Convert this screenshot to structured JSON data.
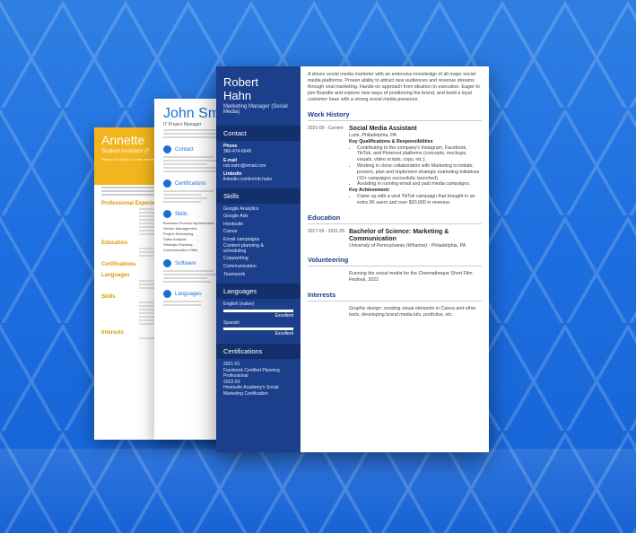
{
  "back_resume": {
    "name": "Annette",
    "title": "Student Assistant (F",
    "contact": "Phone: 0-0-0000 • E-mail: annette@mail.com",
    "sections": [
      "Professional Experie",
      "Education",
      "Certifications",
      "Languages",
      "Skills",
      "Interests"
    ]
  },
  "middle_resume": {
    "name": "John Sm",
    "title": "IT Project Manager",
    "sections": [
      "Contact",
      "Certifications",
      "Skills",
      "Software",
      "Languages"
    ],
    "skills": [
      "Business Process Improvement",
      "Vendor Management",
      "Project Scheduling",
      "Sales Analysis",
      "Strategic Planning",
      "Communication Skills"
    ]
  },
  "front_resume": {
    "name_first": "Robert",
    "name_last": "Hahn",
    "job_title": "Marketing Manager (Social Media)",
    "sidebar": {
      "contact_heading": "Contact",
      "phone_label": "Phone",
      "phone": "360-474-6649",
      "email_label": "E-mail",
      "email": "rob.hahn@email.com",
      "linkedin_label": "LinkedIn",
      "linkedin": "linkedin.com/in/rob.hahn",
      "skills_heading": "Skills",
      "skills": [
        "Google Analytics",
        "Google Ads",
        "Hootsuite",
        "Canva",
        "Email campaigns",
        "Content planning &",
        "scheduling",
        "Copywriting",
        "Communication",
        "Teamwork"
      ],
      "languages_heading": "Languages",
      "languages": [
        {
          "name": "English (native)",
          "level": "Excellent"
        },
        {
          "name": "Spanish",
          "level": "Excellent"
        }
      ],
      "certifications_heading": "Certifications",
      "certifications": [
        {
          "date": "2021-01",
          "name": "Facebook Certified Planning Professional"
        },
        {
          "date": "2022-03",
          "name": "Hootsuite Academy's Social Marketing Certification"
        }
      ]
    },
    "summary": "A driven social media marketer with an extensive knowledge of all major social media platforms. Proven ability to attract new audiences and revenue streams through viral marketing. Hands-on approach from ideation to execution. Eager to join Brandle and explore new ways of positioning the brand, and build a loyal customer base with a strong social media presence.",
    "work_heading": "Work History",
    "work": {
      "dates": "2021-09 - Current",
      "title": "Social Media Assistant",
      "company": "Lumi, Philadelphia, PA",
      "qual_heading": "Key Qualifications & Responsibilities",
      "bullets": [
        "Contributing to the company's Instagram, Facebook, TikTok, and Pinterest platforms (concepts, mockups, visuals, video scripts, copy, etc.).",
        "Working in close collaboration with Marketing to initiate, present, plan and implement strategic marketing initiatives (10+ campaigns succesfully launched).",
        "Assisting in running email and paid media campaigns."
      ],
      "achievement_heading": "Key Achievement:",
      "achievements": [
        "Came up with a viral TikTok campaign that brought in an extra 3K users and over $20,000 in revenue."
      ]
    },
    "education_heading": "Education",
    "education": {
      "dates": "2017-09 - 2021-05",
      "degree": "Bachelor of Science: Marketing & Communication",
      "school": "University of Pennsylvania (Wharton)",
      "location": " - Philadelphia, PA"
    },
    "volunteering_heading": "Volunteering",
    "volunteering": "Running the social media for the Cinematheque Short Film Festival, 2022",
    "interests_heading": "Interests",
    "interests": "Graphic design: creating visual elements in Canva and other tools, developing brand media kits, portfolios, etc."
  }
}
